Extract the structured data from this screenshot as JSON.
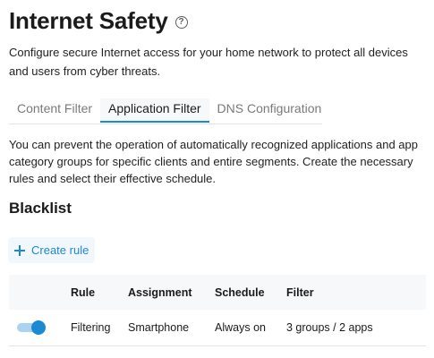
{
  "header": {
    "title": "Internet Safety",
    "help_icon": "help-circle-icon",
    "intro": "Configure secure Internet access for your home network to protect all devices and users from cyber threats."
  },
  "tabs": [
    {
      "label": "Content Filter",
      "active": false
    },
    {
      "label": "Application Filter",
      "active": true
    },
    {
      "label": "DNS Configuration",
      "active": false
    }
  ],
  "description": "You can prevent the operation of automatically recognized applications and app category groups for specific clients and entire segments. Create the necessary rules and select their effective schedule.",
  "blacklist": {
    "title": "Blacklist",
    "create_rule_label": "Create rule",
    "columns": {
      "rule": "Rule",
      "assignment": "Assignment",
      "schedule": "Schedule",
      "filter": "Filter"
    },
    "rows": [
      {
        "enabled": true,
        "rule": "Filtering",
        "assignment": "Smartphone",
        "schedule": "Always on",
        "filter": "3 groups / 2 apps"
      }
    ]
  },
  "colors": {
    "accent": "#1b8ad3",
    "toggle_track": "#a9d3ef",
    "header_bg": "#f7f8f9"
  }
}
